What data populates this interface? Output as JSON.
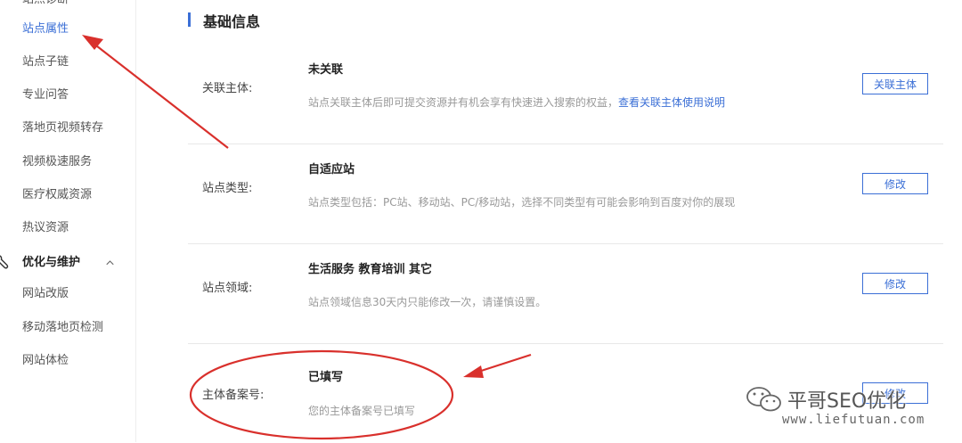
{
  "sidebar": {
    "top_cut": "站点诊断",
    "items": [
      {
        "label": "站点属性",
        "active": true
      },
      {
        "label": "站点子链"
      },
      {
        "label": "专业问答"
      },
      {
        "label": "落地页视频转存"
      },
      {
        "label": "视频极速服务"
      },
      {
        "label": "医疗权威资源"
      },
      {
        "label": "热议资源"
      }
    ],
    "group": {
      "label": "优化与维护",
      "icon": "wrench-icon",
      "expanded": true
    },
    "group_items": [
      {
        "label": "网站改版"
      },
      {
        "label": "移动落地页检测"
      },
      {
        "label": "网站体检"
      }
    ]
  },
  "main": {
    "section_title": "基础信息",
    "rows": [
      {
        "label": "关联主体:",
        "value": "未关联",
        "desc": "站点关联主体后即可提交资源并有机会享有快速进入搜索的权益，",
        "link": "查看关联主体使用说明",
        "button": "关联主体"
      },
      {
        "label": "站点类型:",
        "value": "自适应站",
        "desc": "站点类型包括：PC站、移动站、PC/移动站，选择不同类型有可能会影响到百度对你的展现",
        "button": "修改"
      },
      {
        "label": "站点领域:",
        "value": "生活服务 教育培训 其它",
        "desc": "站点领域信息30天内只能修改一次，请谨慎设置。",
        "button": "修改"
      },
      {
        "label": "主体备案号:",
        "value": "已填写",
        "desc": "您的主体备案号已填写",
        "button": "修改"
      }
    ]
  },
  "watermark": {
    "name": "平哥SEO优化",
    "url": "www.liefutuan.com"
  },
  "colors": {
    "accent": "#3b6fd6",
    "annotation": "#d9302c"
  }
}
